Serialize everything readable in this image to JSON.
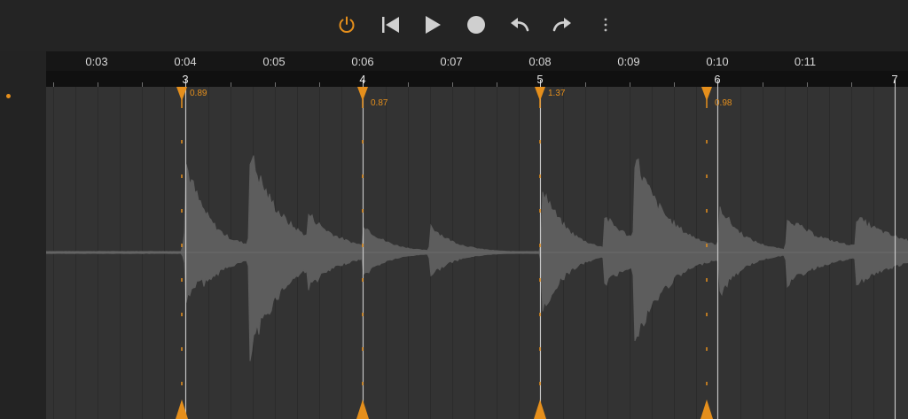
{
  "toolbar": {
    "buttons": [
      {
        "name": "power-button",
        "icon": "power-icon",
        "active": true
      },
      {
        "name": "skip-to-start-button",
        "icon": "skip-back-icon"
      },
      {
        "name": "play-button",
        "icon": "play-icon"
      },
      {
        "name": "record-button",
        "icon": "record-icon"
      },
      {
        "name": "undo-button",
        "icon": "undo-icon"
      },
      {
        "name": "redo-button",
        "icon": "redo-icon"
      },
      {
        "name": "more-button",
        "icon": "more-vertical-icon"
      }
    ]
  },
  "timeline": {
    "time_labels": [
      "0:03",
      "0:04",
      "0:05",
      "0:06",
      "0:07",
      "0:08",
      "0:09",
      "0:10",
      "0:11"
    ],
    "bar_labels": [
      "3",
      "4",
      "5",
      "6",
      "7"
    ]
  },
  "markers": [
    {
      "value": "0.89"
    },
    {
      "value": "0.87"
    },
    {
      "value": "1.37"
    },
    {
      "value": "0.98"
    }
  ],
  "colors": {
    "accent": "#e58f1c",
    "waveform": "#5d5d5d",
    "track_bg": "#333333",
    "grid_line": "#2a2a2a",
    "bar_line": "#c8c8c8"
  }
}
